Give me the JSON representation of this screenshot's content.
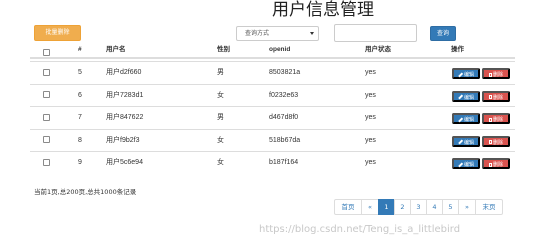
{
  "title": "用户信息管理",
  "toolbar": {
    "batch_delete_label": "批量删除",
    "query_select_value": "查询方式",
    "query_input_value": "",
    "query_button_label": "查询"
  },
  "table": {
    "headers": [
      "#",
      "用户名",
      "性别",
      "openid",
      "用户状态",
      "操作"
    ],
    "rows": [
      {
        "id": "5",
        "name": "用户d2f660",
        "gender": "男",
        "openid": "8503821a",
        "status": "yes"
      },
      {
        "id": "6",
        "name": "用户7283d1",
        "gender": "女",
        "openid": "f0232e63",
        "status": "yes"
      },
      {
        "id": "7",
        "name": "用户847622",
        "gender": "男",
        "openid": "d467d8f0",
        "status": "yes"
      },
      {
        "id": "8",
        "name": "用户f9b2f3",
        "gender": "女",
        "openid": "518b67da",
        "status": "yes"
      },
      {
        "id": "9",
        "name": "用户5c6e94",
        "gender": "女",
        "openid": "b187f164",
        "status": "yes"
      }
    ],
    "edit_label": "编辑",
    "delete_label": "删除"
  },
  "page_info": "当前1页,总200页,总共1000条记录",
  "pagination": {
    "first": "首页",
    "prev": "«",
    "pages": [
      "1",
      "2",
      "3",
      "4",
      "5"
    ],
    "next": "»",
    "last": "末页",
    "active": "1"
  },
  "watermark": "https://blog.csdn.net/Teng_is_a_littlebird",
  "colors": {
    "primary": "#337ab7",
    "danger": "#d9534f",
    "warning": "#f0ad4e"
  },
  "icons": {
    "edit": "pencil-icon",
    "delete": "trash-icon",
    "select": "chevron-down-icon"
  }
}
